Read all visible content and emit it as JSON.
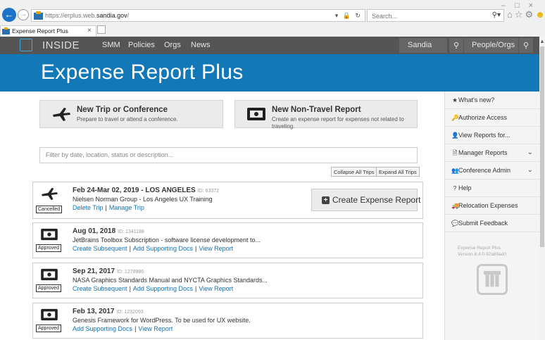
{
  "browser": {
    "url_main": "https://erplus.web.",
    "url_bold": "sandia.gov",
    "url_tail": "/",
    "search_placeholder": "Search...",
    "tab_title": "Expense Report Plus",
    "tab_close": "×"
  },
  "topnav": {
    "brand": "INSIDE",
    "links": [
      "SMM",
      "Policies",
      "Orgs",
      "News"
    ],
    "sandia": "Sandia",
    "people": "People/Orgs"
  },
  "header": {
    "title": "Expense Report Plus"
  },
  "tiles": [
    {
      "title": "New Trip or Conference",
      "subtitle": "Prepare to travel or attend a conference."
    },
    {
      "title": "New Non-Travel Report",
      "subtitle": "Create an expense report for expenses not related to traveling."
    }
  ],
  "filter": {
    "placeholder": "Filter by date, location, status or description..."
  },
  "buttons": {
    "collapse": "Collapse All Trips",
    "expand": "Expand All Trips",
    "create": "Create Expense Report"
  },
  "trips": [
    {
      "date": "Feb 24-Mar 02, 2019 - LOS ANGELES",
      "id": "ID: 63372",
      "desc": "Nielsen Norman Group - Los Angeles UX Training",
      "status": "Cancelled",
      "actions": [
        "Delete Trip",
        "Manage Trip"
      ]
    },
    {
      "date": "Aug 01, 2018",
      "id": "ID: 1341188",
      "desc": "JetBrains Toolbox Subscription - software license development to...",
      "status": "Approved",
      "actions": [
        "Create Subsequent",
        "Add Supporting Docs",
        "View Report"
      ]
    },
    {
      "date": "Sep 21, 2017",
      "id": "ID: 1278986",
      "desc": "NASA Graphics Standards Manual and NYCTA Graphics Standards...",
      "status": "Approved",
      "actions": [
        "Create Subsequent",
        "Add Supporting Docs",
        "View Report"
      ]
    },
    {
      "date": "Feb 13, 2017",
      "id": "ID: 1232093",
      "desc": "Genesis Framework for WordPress. To be used for UX website.",
      "status": "Approved",
      "actions": [
        "Add Supporting Docs",
        "View Report"
      ]
    }
  ],
  "sidebar": {
    "items": [
      {
        "icon": "★",
        "label": "What's new?"
      },
      {
        "icon": "🔑",
        "label": "Authorize Access"
      },
      {
        "icon": "👤",
        "label": "View Reports for..."
      },
      {
        "icon": "🗎",
        "label": "Manager Reports"
      },
      {
        "icon": "👥",
        "label": "Conference Admin"
      },
      {
        "icon": "?",
        "label": "Help"
      },
      {
        "icon": "🚚",
        "label": "Relocation Expenses"
      },
      {
        "icon": "💬",
        "label": "Submit Feedback"
      }
    ],
    "version_line1": "Expense Report Plus",
    "version_line2": "Version 8.4.0-92a69ad0"
  },
  "colors": {
    "accent": "#1278b8",
    "link": "#1270b2",
    "nav": "#555555"
  }
}
